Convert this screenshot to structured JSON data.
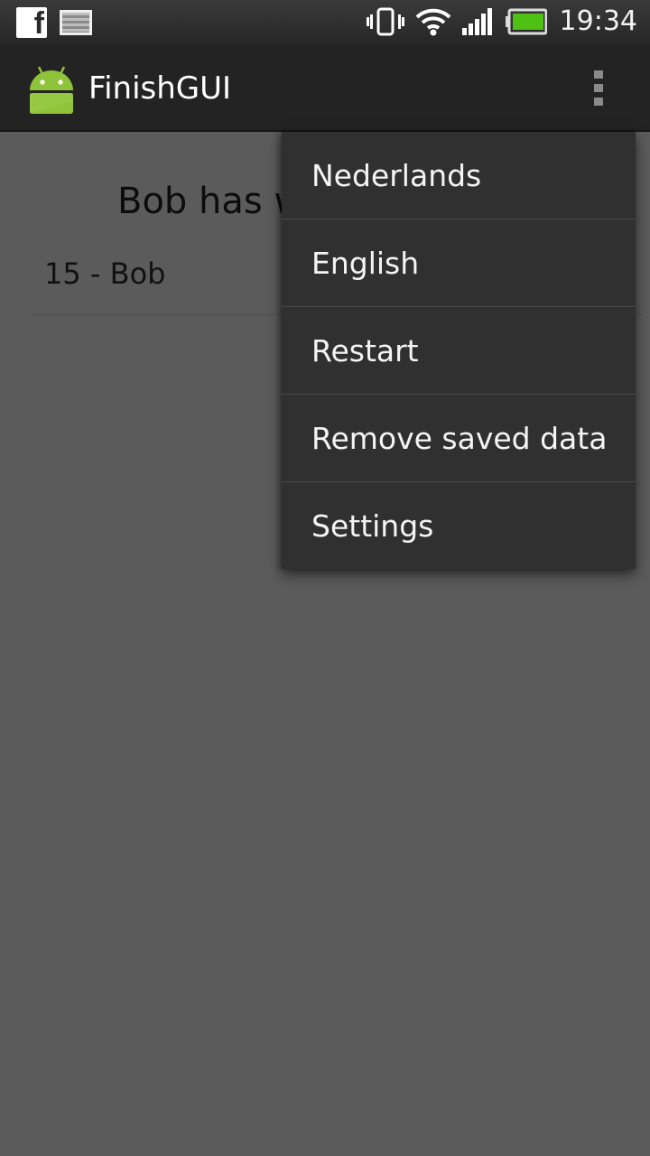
{
  "status_bar": {
    "time": "19:34",
    "icons": [
      "facebook-icon",
      "gallery-icon",
      "vibrate-icon",
      "wifi-icon",
      "signal-icon",
      "battery-icon"
    ],
    "facebook_glyph": "f",
    "battery_color": "#4fc014"
  },
  "action_bar": {
    "title": "FinishGUI",
    "app_icon": "android-icon",
    "icon_color": "#8fc43a"
  },
  "main": {
    "winner_text": "Bob has w",
    "scores": [
      {
        "label": "15 - Bob"
      }
    ]
  },
  "menu": {
    "items": [
      {
        "label": "Nederlands"
      },
      {
        "label": "English"
      },
      {
        "label": "Restart"
      },
      {
        "label": "Remove saved data"
      },
      {
        "label": "Settings"
      }
    ]
  }
}
